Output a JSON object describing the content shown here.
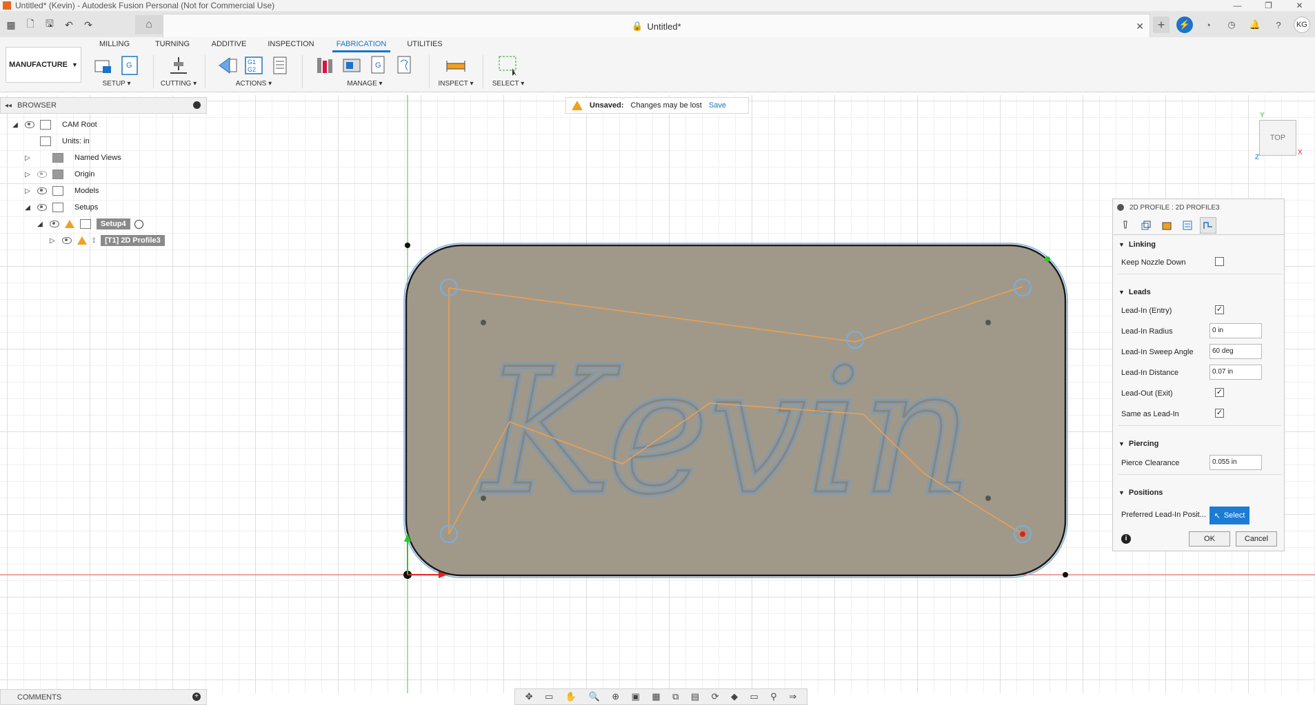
{
  "window": {
    "title": "Untitled* (Kevin) - Autodesk Fusion Personal (Not for Commercial Use)",
    "controls": [
      "—",
      "❐",
      "✕"
    ]
  },
  "doc_tab": {
    "title": "Untitled*"
  },
  "user": {
    "initials": "KG"
  },
  "ribbon": {
    "workspace": "MANUFACTURE",
    "tabs": [
      "MILLING",
      "TURNING",
      "ADDITIVE",
      "INSPECTION",
      "FABRICATION",
      "UTILITIES"
    ],
    "active_tab": "FABRICATION",
    "groups": {
      "setup": "SETUP ▾",
      "cutting": "CUTTING ▾",
      "actions": "ACTIONS ▾",
      "manage": "MANAGE ▾",
      "inspect": "INSPECT ▾",
      "select": "SELECT ▾"
    }
  },
  "browser": {
    "title": "BROWSER",
    "items": [
      {
        "label": "CAM Root"
      },
      {
        "label": "Units: in"
      },
      {
        "label": "Named Views"
      },
      {
        "label": "Origin"
      },
      {
        "label": "Models"
      },
      {
        "label": "Setups"
      },
      {
        "label": "Setup4"
      },
      {
        "label": "[T1] 2D Profile3"
      }
    ]
  },
  "banner": {
    "title": "Unsaved:",
    "message": "Changes may be lost",
    "action": "Save"
  },
  "viewcube": {
    "label": "TOP",
    "axis_x": "X",
    "axis_y": "Y",
    "axis_z": "Z"
  },
  "canvas": {
    "text": "Kevin"
  },
  "dialog": {
    "title": "2D PROFILE : 2D PROFILE3",
    "sections": {
      "linking": "Linking",
      "leads": "Leads",
      "piercing": "Piercing",
      "positions": "Positions"
    },
    "fields": {
      "keep_nozzle_down": "Keep Nozzle Down",
      "lead_in": "Lead-In (Entry)",
      "lead_in_radius": "Lead-In Radius",
      "lead_in_radius_value": "0 in",
      "lead_in_sweep": "Lead-In Sweep Angle",
      "lead_in_sweep_value": "60 deg",
      "lead_in_distance": "Lead-In Distance",
      "lead_in_distance_value": "0.07 in",
      "lead_out": "Lead-Out (Exit)",
      "same_as_lead_in": "Same as Lead-In",
      "pierce_clearance": "Pierce Clearance",
      "pierce_clearance_value": "0.055 in",
      "preferred_lead_in": "Preferred Lead-In Posit...",
      "select_btn": "Select"
    },
    "buttons": {
      "ok": "OK",
      "cancel": "Cancel"
    }
  },
  "comments": {
    "title": "COMMENTS"
  }
}
